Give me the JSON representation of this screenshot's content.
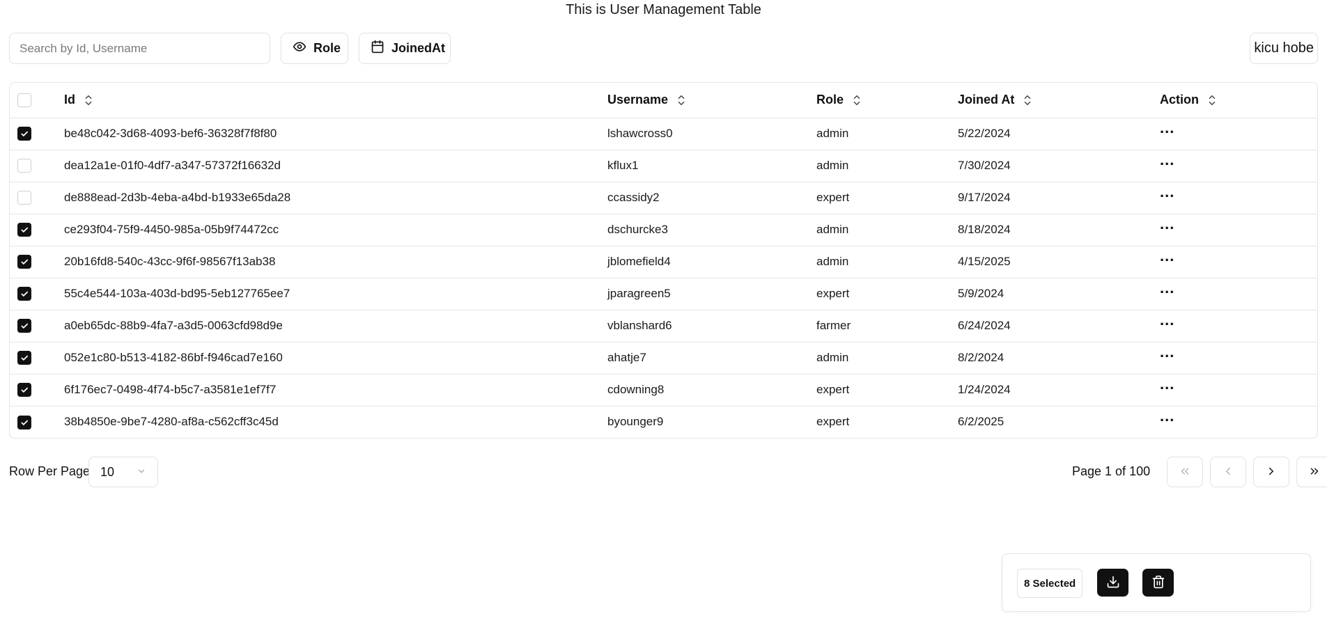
{
  "page": {
    "title": "This is User Management Table"
  },
  "toolbar": {
    "search_placeholder": "Search by Id, Username",
    "search_value": "",
    "role_button": "Role",
    "role_icon": "eye-icon",
    "joined_button": "JoinedAt",
    "joined_icon": "calendar-icon",
    "user_button": "kicu hobe"
  },
  "table": {
    "columns": [
      "Id",
      "Username",
      "Role",
      "Joined At",
      "Action"
    ],
    "header_checked": false,
    "action_label": "...",
    "rows": [
      {
        "checked": true,
        "id": "be48c042-3d68-4093-bef6-36328f7f8f80",
        "username": "lshawcross0",
        "role": "admin",
        "joined": "5/22/2024"
      },
      {
        "checked": false,
        "id": "dea12a1e-01f0-4df7-a347-57372f16632d",
        "username": "kflux1",
        "role": "admin",
        "joined": "7/30/2024"
      },
      {
        "checked": false,
        "id": "de888ead-2d3b-4eba-a4bd-b1933e65da28",
        "username": "ccassidy2",
        "role": "expert",
        "joined": "9/17/2024"
      },
      {
        "checked": true,
        "id": "ce293f04-75f9-4450-985a-05b9f74472cc",
        "username": "dschurcke3",
        "role": "admin",
        "joined": "8/18/2024"
      },
      {
        "checked": true,
        "id": "20b16fd8-540c-43cc-9f6f-98567f13ab38",
        "username": "jblomefield4",
        "role": "admin",
        "joined": "4/15/2025"
      },
      {
        "checked": true,
        "id": "55c4e544-103a-403d-bd95-5eb127765ee7",
        "username": "jparagreen5",
        "role": "expert",
        "joined": "5/9/2024"
      },
      {
        "checked": true,
        "id": "a0eb65dc-88b9-4fa7-a3d5-0063cfd98d9e",
        "username": "vblanshard6",
        "role": "farmer",
        "joined": "6/24/2024"
      },
      {
        "checked": true,
        "id": "052e1c80-b513-4182-86bf-f946cad7e160",
        "username": "ahatje7",
        "role": "admin",
        "joined": "8/2/2024"
      },
      {
        "checked": true,
        "id": "6f176ec7-0498-4f74-b5c7-a3581e1ef7f7",
        "username": "cdowning8",
        "role": "expert",
        "joined": "1/24/2024"
      },
      {
        "checked": true,
        "id": "38b4850e-9be7-4280-af8a-c562cff3c45d",
        "username": "byounger9",
        "role": "expert",
        "joined": "6/2/2025"
      }
    ]
  },
  "pagination": {
    "rows_per_page_label": "Row Per Page",
    "rows_per_page_value": "10",
    "page_info": "Page 1 of 100",
    "first_disabled": true,
    "prev_disabled": true
  },
  "selection": {
    "count_label": "8 Selected",
    "download_icon": "download-icon",
    "delete_icon": "trash-icon"
  },
  "colors": {
    "primary": "#111111",
    "border": "#e5e5e5",
    "muted": "#7a7a7a"
  }
}
